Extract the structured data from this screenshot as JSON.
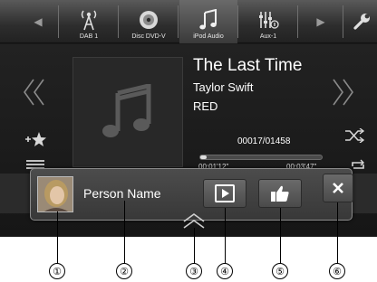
{
  "topbar": {
    "sources": [
      {
        "label": "DAB 1",
        "icon": "antenna-icon"
      },
      {
        "label": "Disc DVD-V",
        "icon": "disc-icon"
      },
      {
        "label": "iPod Audio",
        "icon": "music-note-icon"
      },
      {
        "label": "Aux-1",
        "icon": "aux-icon"
      }
    ],
    "active_index": 2
  },
  "now_playing": {
    "title": "The Last Time",
    "artist": "Taylor Swift",
    "album": "RED",
    "track_counter": "00017/01458",
    "elapsed": "00:01'12\"",
    "remaining": "00:03'47\"",
    "progress_fraction": 0.05
  },
  "popup": {
    "person_name": "Person Name"
  },
  "callouts": [
    "①",
    "②",
    "③",
    "④",
    "⑤",
    "⑥"
  ],
  "colors": {
    "screen_bg": "#1b1b1b",
    "accent_text": "#ffffff"
  }
}
